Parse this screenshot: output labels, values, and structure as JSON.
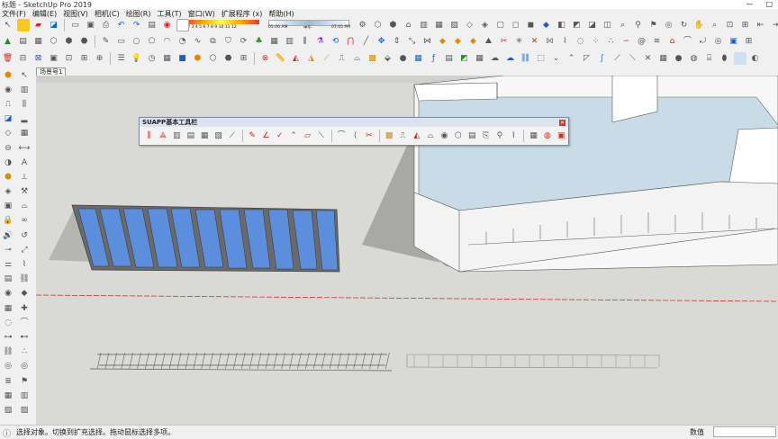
{
  "window": {
    "title": "标题 - SketchUp Pro 2019",
    "controls": [
      "—",
      "□",
      "✕"
    ]
  },
  "menu": [
    {
      "label": "文件(F)"
    },
    {
      "label": "编辑(E)"
    },
    {
      "label": "视图(V)"
    },
    {
      "label": "相机(C)"
    },
    {
      "label": "绘图(R)"
    },
    {
      "label": "工具(T)"
    },
    {
      "label": "窗口(W)"
    },
    {
      "label": "扩展程序 (x)"
    },
    {
      "label": "帮助(H)"
    }
  ],
  "shadow_bar": {
    "months": "1 2 3 4 5 6 7 8 9 10 11 12",
    "time_start": "05:06 AM",
    "noon": "中午",
    "time_end": "07:05 PM"
  },
  "scene_tab": "场景号1",
  "suapp_panel": {
    "title": "SUAPP基本工具栏"
  },
  "status": {
    "text": "选择对象。切换到扩充选择。拖动鼠标选择多项。",
    "measure_label": "数值",
    "measure_value": ""
  },
  "colors": {
    "accent_blue": "#1a5fc7",
    "glass": "#5b8fde",
    "floor": "#d9d9d6",
    "water": "#c9dbe6",
    "axis_red": "#d23030"
  }
}
